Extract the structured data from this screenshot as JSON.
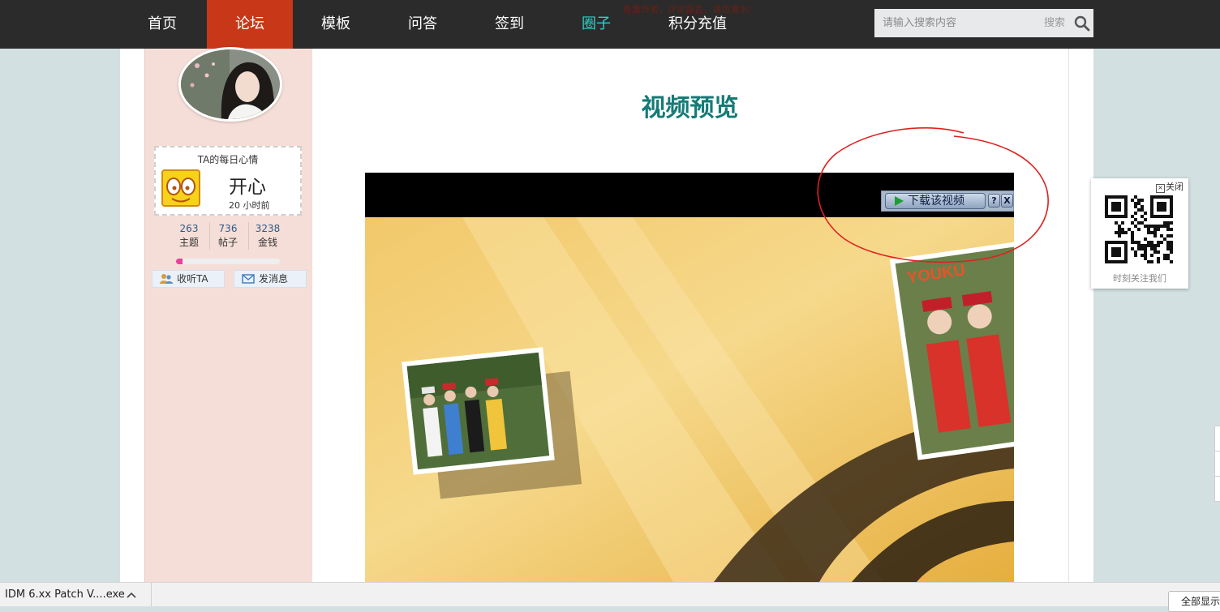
{
  "nav": {
    "items": [
      {
        "label": "首页"
      },
      {
        "label": "论坛"
      },
      {
        "label": "模板"
      },
      {
        "label": "问答"
      },
      {
        "label": "签到"
      },
      {
        "label": "圈子"
      },
      {
        "label": "积分充值"
      }
    ],
    "active_index": 1,
    "highlight_index": 5,
    "notice": "尊重作者，评论留言，请勿灌水！",
    "search": {
      "placeholder": "请输入搜索内容",
      "button_label": "搜索"
    }
  },
  "sidebar": {
    "mood": {
      "title": "TA的每日心情",
      "value": "开心",
      "time": "20 小时前"
    },
    "stats": [
      {
        "value": "263",
        "label": "主题"
      },
      {
        "value": "736",
        "label": "帖子"
      },
      {
        "value": "3238",
        "label": "金钱"
      }
    ],
    "level_progress_percent": 6,
    "buttons": {
      "follow": "收听TA",
      "message": "发消息"
    }
  },
  "main": {
    "heading": "视频预览",
    "video": {
      "download_label": "下载该视频",
      "help_label": "?",
      "close_label": "X",
      "watermark": "YOUKU"
    }
  },
  "qr_widget": {
    "close_label": "关闭",
    "caption": "时刻关注我们"
  },
  "download_bar": {
    "filename": "IDM 6.xx Patch V....exe",
    "show_all_label": "全部显示"
  },
  "colors": {
    "nav_bg": "#2b2b2b",
    "nav_active": "#c83717",
    "nav_highlight": "#27d6c8",
    "heading": "#147b77",
    "sidebar_bg": "#f5ded8"
  }
}
